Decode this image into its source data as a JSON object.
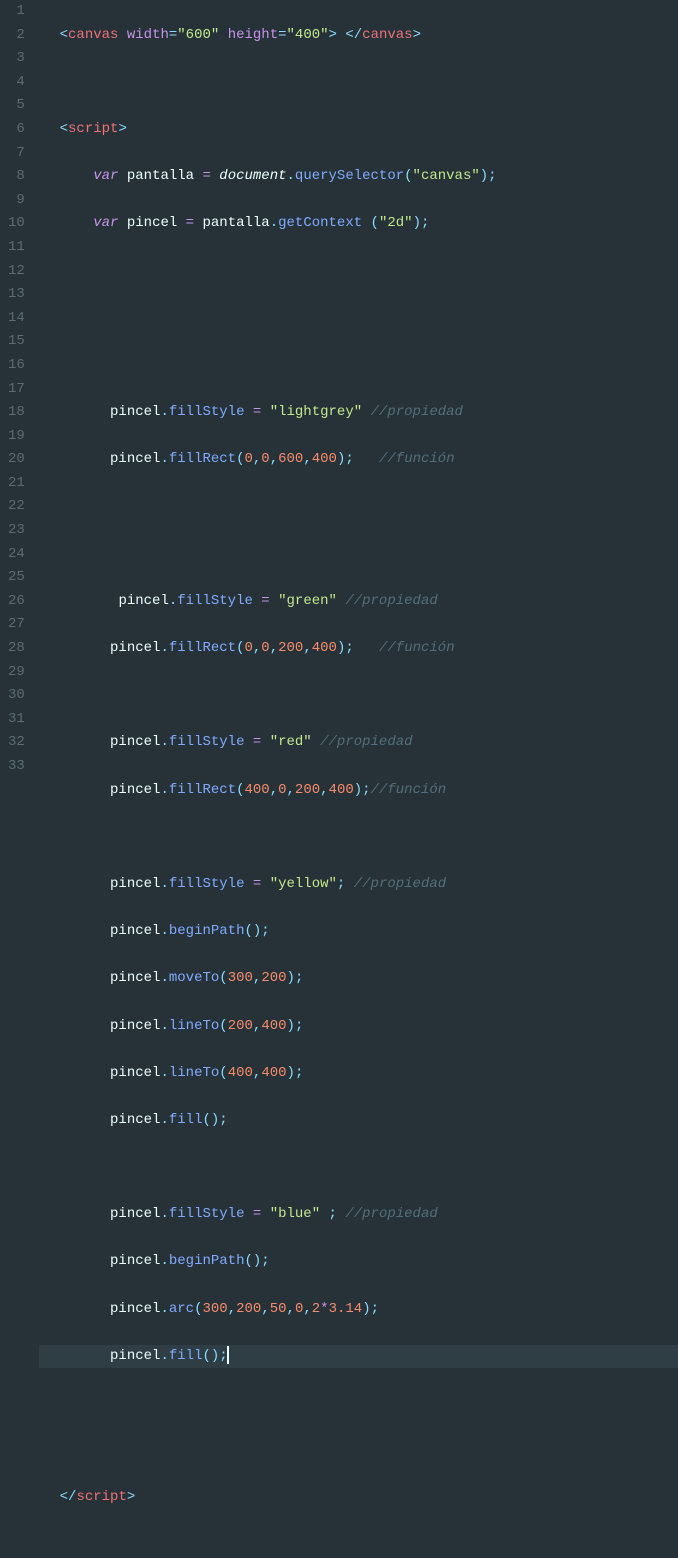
{
  "gutter": [
    "1",
    "2",
    "3",
    "4",
    "5",
    "6",
    "7",
    "8",
    "9",
    "10",
    "11",
    "12",
    "13",
    "14",
    "15",
    "16",
    "17",
    "18",
    "19",
    "20",
    "21",
    "22",
    "23",
    "24",
    "25",
    "26",
    "27",
    "28",
    "29",
    "30",
    "31",
    "32",
    "33"
  ],
  "lines": {
    "l1": {
      "indent": "  ",
      "canvas": "canvas",
      "width_attr": "width",
      "width_val": "\"600\"",
      "height_attr": "height",
      "height_val": "\"400\""
    },
    "l2": "",
    "l3": {
      "indent": "  ",
      "script": "script"
    },
    "l4": {
      "indent": "      ",
      "var": "var",
      "pantalla": "pantalla",
      "eq": " = ",
      "document": "document",
      "dot": ".",
      "qs": "querySelector",
      "open": "(",
      "arg": "\"canvas\"",
      "close": ")",
      "semi": ";"
    },
    "l5": {
      "indent": "      ",
      "var": "var",
      "pincel": "pincel",
      "eq": " = ",
      "pantalla": "pantalla",
      "dot": ".",
      "gc": "getContext",
      "sp": " ",
      "open": "(",
      "arg": "\"2d\"",
      "close": ")",
      "semi": ";"
    },
    "l6": "",
    "l7": "",
    "l8": "",
    "l9": {
      "indent": "        ",
      "pincel": "pincel",
      "dot": ".",
      "fs": "fillStyle",
      "eq": " = ",
      "val": "\"lightgrey\"",
      "sp": " ",
      "comment": "//propiedad"
    },
    "l10": {
      "indent": "        ",
      "pincel": "pincel",
      "dot": ".",
      "fr": "fillRect",
      "open": "(",
      "a": "0",
      "c": ",",
      "b": "0",
      "c2": ",",
      "d": "600",
      "c3": ",",
      "e": "400",
      "close": ")",
      "semi": ";",
      "sp": "   ",
      "comment": "//función"
    },
    "l11": "",
    "l12": "",
    "l13": {
      "indent": "         ",
      "pincel": "pincel",
      "dot": ".",
      "fs": "fillStyle",
      "eq": " = ",
      "val": "\"green\"",
      "sp": " ",
      "comment": "//propiedad"
    },
    "l14": {
      "indent": "        ",
      "pincel": "pincel",
      "dot": ".",
      "fr": "fillRect",
      "open": "(",
      "a": "0",
      "c": ",",
      "b": "0",
      "c2": ",",
      "d": "200",
      "c3": ",",
      "e": "400",
      "close": ")",
      "semi": ";",
      "sp": "   ",
      "comment": "//función"
    },
    "l15": "",
    "l16": {
      "indent": "        ",
      "pincel": "pincel",
      "dot": ".",
      "fs": "fillStyle",
      "eq": " = ",
      "val": "\"red\"",
      "sp": " ",
      "comment": "//propiedad"
    },
    "l17": {
      "indent": "        ",
      "pincel": "pincel",
      "dot": ".",
      "fr": "fillRect",
      "open": "(",
      "a": "400",
      "c": ",",
      "b": "0",
      "c2": ",",
      "d": "200",
      "c3": ",",
      "e": "400",
      "close": ")",
      "semi": ";",
      "comment": "//función"
    },
    "l18": "",
    "l19": {
      "indent": "        ",
      "pincel": "pincel",
      "dot": ".",
      "fs": "fillStyle",
      "eq": " = ",
      "val": "\"yellow\"",
      "semi": ";",
      "sp": " ",
      "comment": "//propiedad"
    },
    "l20": {
      "indent": "        ",
      "pincel": "pincel",
      "dot": ".",
      "bp": "beginPath",
      "open": "(",
      "close": ")",
      "semi": ";"
    },
    "l21": {
      "indent": "        ",
      "pincel": "pincel",
      "dot": ".",
      "mv": "moveTo",
      "open": "(",
      "a": "300",
      "c": ",",
      "b": "200",
      "close": ")",
      "semi": ";"
    },
    "l22": {
      "indent": "        ",
      "pincel": "pincel",
      "dot": ".",
      "lt": "lineTo",
      "open": "(",
      "a": "200",
      "c": ",",
      "b": "400",
      "close": ")",
      "semi": ";"
    },
    "l23": {
      "indent": "        ",
      "pincel": "pincel",
      "dot": ".",
      "lt": "lineTo",
      "open": "(",
      "a": "400",
      "c": ",",
      "b": "400",
      "close": ")",
      "semi": ";"
    },
    "l24": {
      "indent": "        ",
      "pincel": "pincel",
      "dot": ".",
      "fill": "fill",
      "open": "(",
      "close": ")",
      "semi": ";"
    },
    "l25": "",
    "l26": {
      "indent": "        ",
      "pincel": "pincel",
      "dot": ".",
      "fs": "fillStyle",
      "eq": " = ",
      "val": "\"blue\"",
      "sp": " ",
      "semi2": ";",
      "sp2": " ",
      "comment": "//propiedad"
    },
    "l27": {
      "indent": "        ",
      "pincel": "pincel",
      "dot": ".",
      "bp": "beginPath",
      "open": "(",
      "close": ")",
      "semi": ";"
    },
    "l28": {
      "indent": "        ",
      "pincel": "pincel",
      "dot": ".",
      "arc": "arc",
      "open": "(",
      "a": "300",
      "c": ",",
      "b": "200",
      "c2": ",",
      "d": "50",
      "c3": ",",
      "e": "0",
      "c4": ",",
      "f": "2",
      "mul": "*",
      "g": "3.14",
      "close": ")",
      "semi": ";"
    },
    "l29": {
      "indent": "        ",
      "pincel": "pincel",
      "dot": ".",
      "fill": "fill",
      "open": "(",
      "close": ")",
      "semi": ";"
    },
    "l30": "",
    "l31": "",
    "l32": {
      "indent": "  ",
      "script": "script"
    },
    "l33": ""
  }
}
